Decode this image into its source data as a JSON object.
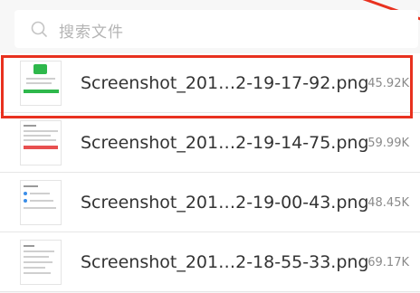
{
  "search": {
    "placeholder": "搜索文件"
  },
  "files": [
    {
      "name": "Screenshot_201…2-19-17-92.png",
      "size": "45.92K",
      "highlighted": true
    },
    {
      "name": "Screenshot_201…2-19-14-75.png",
      "size": "59.99K",
      "highlighted": false
    },
    {
      "name": "Screenshot_201…2-19-00-43.png",
      "size": "48.45K",
      "highlighted": false
    },
    {
      "name": "Screenshot_201…2-18-55-33.png",
      "size": "69.17K",
      "highlighted": false
    }
  ],
  "colors": {
    "highlight": "#e8311f",
    "thumb_green": "#2eb84b",
    "thumb_red": "#e85050",
    "background": "#f7f7f7"
  },
  "icons": {
    "search": "search-icon",
    "thumbnail": "image-thumbnail-icon"
  }
}
